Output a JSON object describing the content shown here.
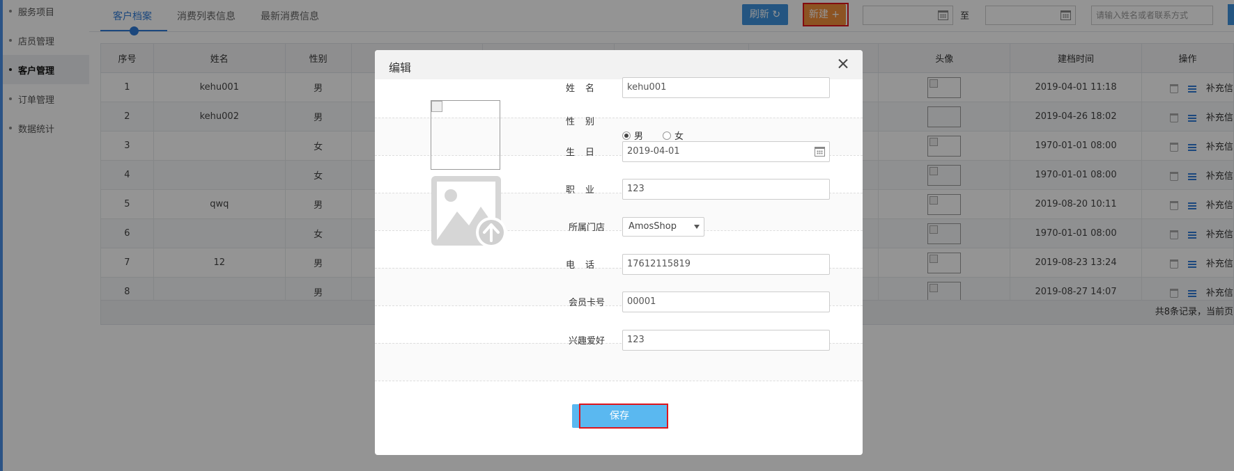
{
  "sidebar": {
    "items": [
      {
        "label": "服务项目"
      },
      {
        "label": "店员管理"
      },
      {
        "label": "客户管理",
        "active": true
      },
      {
        "label": "订单管理"
      },
      {
        "label": "数据统计"
      }
    ]
  },
  "tabs": [
    {
      "label": "客户档案",
      "active": true
    },
    {
      "label": "消费列表信息"
    },
    {
      "label": "最新消费信息"
    }
  ],
  "toolbar": {
    "refresh_label": "刷新 ↻",
    "new_label": "新建 +",
    "date_to_label": "至",
    "search_placeholder": "请输入姓名或者联系方式"
  },
  "table": {
    "headers": {
      "index": "序号",
      "name": "姓名",
      "gender": "性别",
      "avatar": "头像",
      "created": "建档时间",
      "actions": "操作"
    },
    "rows": [
      {
        "index": "1",
        "name": "kehu001",
        "gender": "男",
        "created": "2019-04-01 11:18",
        "op": "补充信"
      },
      {
        "index": "2",
        "name": "kehu002",
        "gender": "男",
        "created": "2019-04-26 18:02",
        "op": "补充信"
      },
      {
        "index": "3",
        "name": "",
        "gender": "女",
        "created": "1970-01-01 08:00",
        "op": "补充信"
      },
      {
        "index": "4",
        "name": "",
        "gender": "女",
        "created": "1970-01-01 08:00",
        "op": "补充信"
      },
      {
        "index": "5",
        "name": "qwq",
        "gender": "男",
        "created": "2019-08-20 10:11",
        "op": "补充信"
      },
      {
        "index": "6",
        "name": "",
        "gender": "女",
        "created": "1970-01-01 08:00",
        "op": "补充信"
      },
      {
        "index": "7",
        "name": "12",
        "gender": "男",
        "created": "2019-08-23 13:24",
        "op": "补充信"
      },
      {
        "index": "8",
        "name": "",
        "gender": "男",
        "created": "2019-08-27 14:07",
        "op": "补充信"
      }
    ],
    "footer": "共8条记录，当前页"
  },
  "modal": {
    "title": "编辑",
    "labels": {
      "name": "姓名",
      "gender": "性别",
      "birthday": "生日",
      "job": "职业",
      "store": "所属门店",
      "phone": "电话",
      "card": "会员卡号",
      "hobby": "兴趣爱好"
    },
    "values": {
      "name": "kehu001",
      "gender_male": "男",
      "gender_female": "女",
      "birthday": "2019-04-01",
      "job": "123",
      "store": "AmosShop",
      "phone": "17612115819",
      "card": "00001",
      "hobby": "123"
    },
    "save_label": "保存"
  },
  "colors": {
    "primary": "#2f7bd8",
    "refresh_bg": "#3e93de",
    "new_bg": "#f28f3b",
    "save_bg": "#5ab8f0",
    "highlight": "#e0141a"
  }
}
